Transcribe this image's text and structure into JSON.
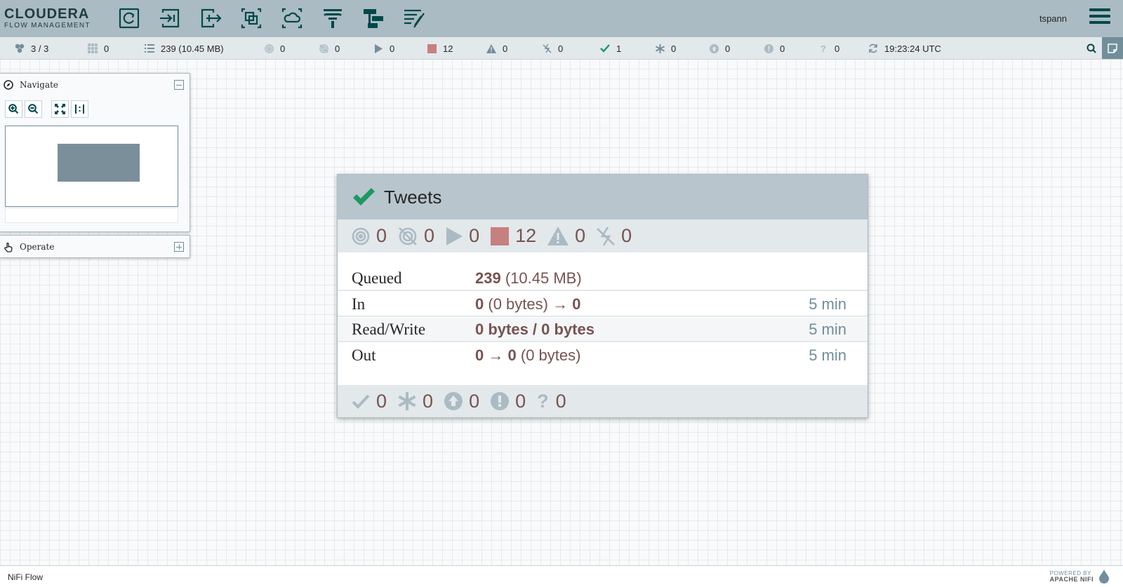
{
  "brand": {
    "name": "CLOUDERA",
    "subtitle": "FLOW MANAGEMENT"
  },
  "toolbar": [
    {
      "name": "processor",
      "icon": "processor-icon"
    },
    {
      "name": "input-port",
      "icon": "input-port-icon"
    },
    {
      "name": "output-port",
      "icon": "output-port-icon"
    },
    {
      "name": "process-group",
      "icon": "process-group-icon"
    },
    {
      "name": "remote-process-group",
      "icon": "remote-process-group-icon"
    },
    {
      "name": "funnel",
      "icon": "funnel-icon"
    },
    {
      "name": "template",
      "icon": "template-icon"
    },
    {
      "name": "label",
      "icon": "label-icon"
    }
  ],
  "user": "tspann",
  "status": {
    "nodes": "3 / 3",
    "threads": "0",
    "queued": "239 (10.45 MB)",
    "transmitting": "0",
    "not_transmitting": "0",
    "running": "0",
    "stopped": "12",
    "invalid": "0",
    "disabled": "0",
    "up_to_date": "1",
    "locally_modified": "0",
    "stale": "0",
    "locally_modified_stale": "0",
    "sync_failure": "0",
    "last_refreshed": "19:23:24 UTC"
  },
  "navigate": {
    "title": "Navigate"
  },
  "operate": {
    "title": "Operate"
  },
  "process_group": {
    "name": "Tweets",
    "counts": {
      "transmitting": "0",
      "not_transmitting": "0",
      "running": "0",
      "stopped": "12",
      "invalid": "0",
      "disabled": "0"
    },
    "rows": {
      "queued_label": "Queued",
      "queued_count": "239",
      "queued_size": "(10.45 MB)",
      "in_label": "In",
      "in_count": "0",
      "in_size": "(0 bytes)",
      "in_arrow": "→",
      "in_ports": "0",
      "in_period": "5 min",
      "rw_label": "Read/Write",
      "rw_value": "0 bytes / 0 bytes",
      "rw_period": "5 min",
      "out_label": "Out",
      "out_ports": "0",
      "out_arrow": "→",
      "out_count": "0",
      "out_size": "(0 bytes)",
      "out_period": "5 min"
    },
    "version_counts": {
      "up_to_date": "0",
      "locally_modified": "0",
      "stale": "0",
      "locally_modified_stale": "0",
      "sync_failure": "0"
    }
  },
  "footer": {
    "breadcrumb": "NiFi Flow",
    "powered_by": "POWERED BY",
    "powered_name": "APACHE NIFI"
  },
  "colors": {
    "header": "#aabbc3",
    "accent": "#004849",
    "stopped": "#ba554a",
    "valid": "#1a9964",
    "value_text": "#775351",
    "muted": "#728e9b"
  }
}
